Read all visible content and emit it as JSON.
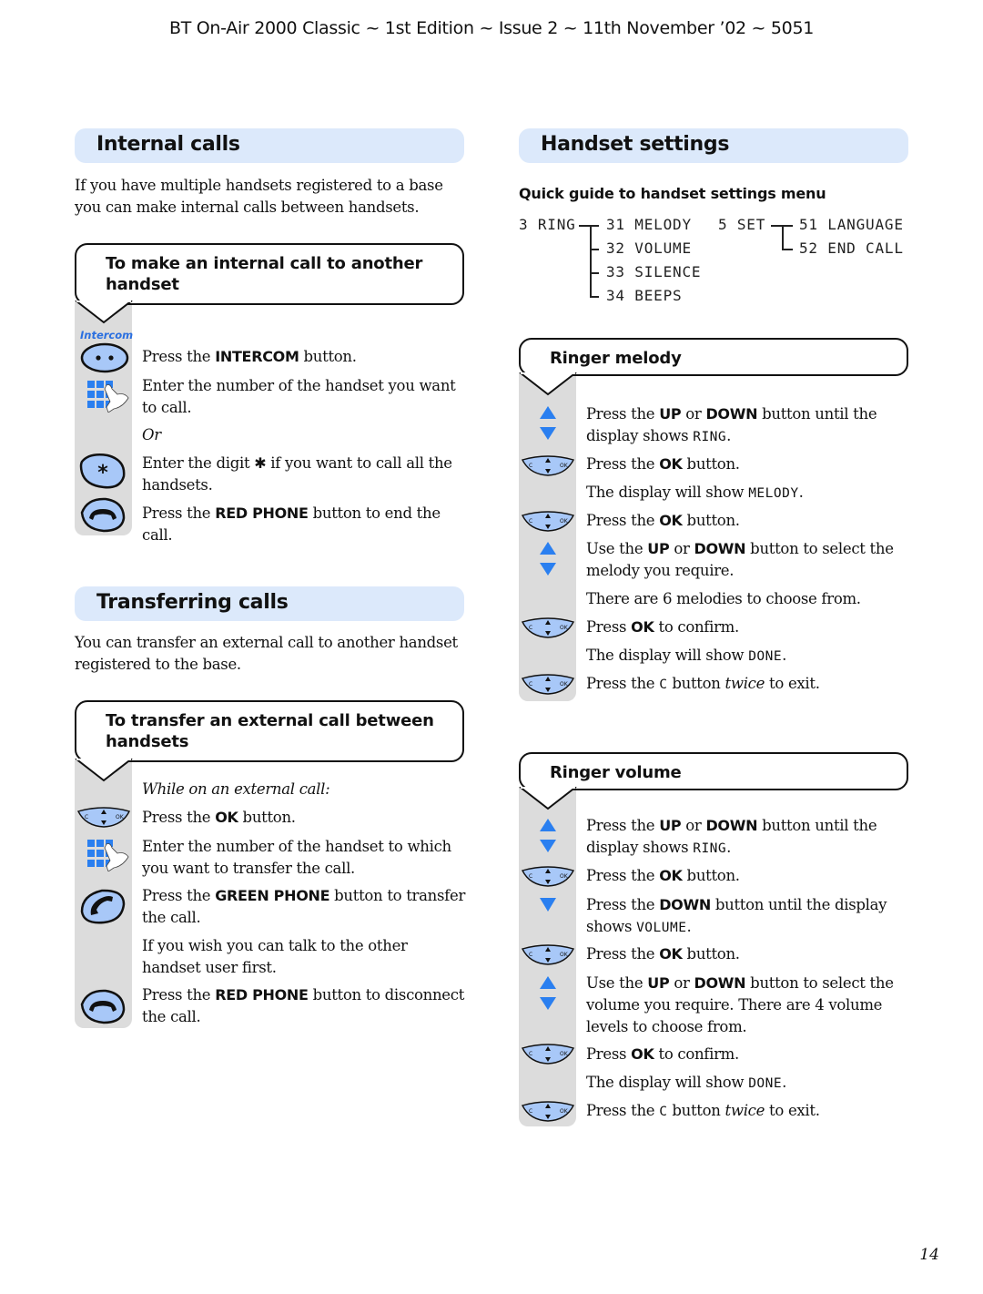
{
  "header": "BT On-Air 2000 Classic ~ 1st Edition ~ Issue 2 ~ 11th November ’02 ~ 5051",
  "page_number": "14",
  "colors": {
    "section_bar": "#dce9fb",
    "icon_fill": "#a8c8f8",
    "arrow_blue": "#2a7ff0",
    "rail_gray": "#dcdcdc",
    "intercom_label": "#2a6fe0"
  },
  "internal_calls": {
    "title": "Internal calls",
    "intro": "If you have multiple handsets registered to a base you can make internal calls between handsets.",
    "procedure_title": "To make an internal call to another handset",
    "intercom_label": "Intercom",
    "steps": [
      {
        "pre": "Press the ",
        "bold": "INTERCOM",
        "post": " button."
      },
      {
        "text": "Enter the number of the handset you want to call."
      },
      {
        "italic": "Or"
      },
      {
        "pre": "Enter the digit ",
        "symbol": "✱",
        "post": " if you want to call all the handsets."
      },
      {
        "pre": "Press the ",
        "bold": "RED PHONE",
        "post": " button to end the call."
      }
    ]
  },
  "transferring_calls": {
    "title": "Transferring calls",
    "intro": "You can transfer an external call to another handset registered to the base.",
    "procedure_title": "To transfer an external call between handsets",
    "steps": [
      {
        "italic": "While on an external call:"
      },
      {
        "pre": "Press the ",
        "bold": "OK",
        "post": " button."
      },
      {
        "text": "Enter the number of the handset to which you want to transfer the call."
      },
      {
        "pre": "Press the ",
        "bold": "GREEN PHONE",
        "post": " button to transfer the call."
      },
      {
        "text": "If you wish you can talk to the other handset user first."
      },
      {
        "pre": "Press the ",
        "bold": "RED PHONE",
        "post": " button to disconnect the call."
      }
    ]
  },
  "handset_settings": {
    "title": "Handset settings",
    "quick_guide_title": "Quick guide to handset settings menu",
    "menu": {
      "ring": {
        "label": "3 RING",
        "items": [
          "31 MELODY",
          "32 VOLUME",
          "33 SILENCE",
          "34 BEEPS"
        ]
      },
      "set": {
        "label": "5 SET",
        "items": [
          "51 LANGUAGE",
          "52 END CALL"
        ]
      }
    }
  },
  "ringer_melody": {
    "title": "Ringer melody",
    "steps": [
      {
        "pre": "Press the ",
        "bold": "UP",
        "mid": " or ",
        "bold2": "DOWN",
        "post": " button until the display shows ",
        "lcd": "RING",
        "end": "."
      },
      {
        "pre": "Press the ",
        "bold": "OK",
        "post": " button."
      },
      {
        "pre": "The display will show ",
        "lcd": "MELODY",
        "end": "."
      },
      {
        "pre": "Press the ",
        "bold": "OK",
        "post": " button."
      },
      {
        "pre": "Use the ",
        "bold": "UP",
        "mid": " or ",
        "bold2": "DOWN",
        "post": " button to select the melody you require."
      },
      {
        "text": "There are 6 melodies to choose from."
      },
      {
        "pre": "Press ",
        "bold": "OK",
        "post": " to confirm."
      },
      {
        "pre": "The display will show ",
        "lcd": "DONE",
        "end": "."
      },
      {
        "pre": "Press the ",
        "lcd": "C",
        "post": " button ",
        "italic": "twice",
        "end": " to exit."
      }
    ]
  },
  "ringer_volume": {
    "title": "Ringer volume",
    "steps": [
      {
        "pre": "Press the ",
        "bold": "UP",
        "mid": " or ",
        "bold2": "DOWN",
        "post": " button until the display shows ",
        "lcd": "RING",
        "end": "."
      },
      {
        "pre": "Press the ",
        "bold": "OK",
        "post": " button."
      },
      {
        "pre": "Press the ",
        "bold": "DOWN",
        "post": " button until the display shows ",
        "lcd": "VOLUME",
        "end": "."
      },
      {
        "pre": "Press the ",
        "bold": "OK",
        "post": " button."
      },
      {
        "pre": "Use the ",
        "bold": "UP",
        "mid": " or ",
        "bold2": "DOWN",
        "post": " button to select the volume you require. There are 4 volume levels to choose from."
      },
      {
        "pre": "Press ",
        "bold": "OK",
        "post": " to confirm."
      },
      {
        "pre": "The display will show ",
        "lcd": "DONE",
        "end": "."
      },
      {
        "pre": "Press the ",
        "lcd": "C",
        "post": " button ",
        "italic": "twice",
        "end": " to exit."
      }
    ]
  }
}
